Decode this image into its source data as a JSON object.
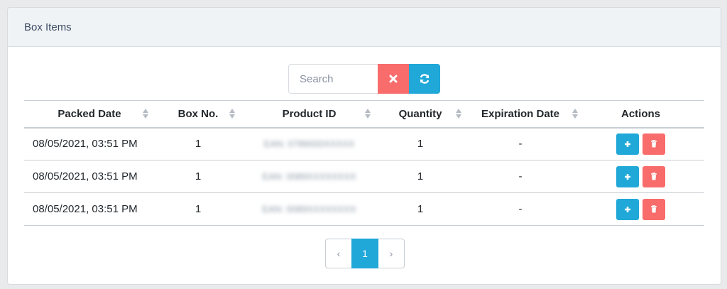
{
  "card": {
    "title": "Box Items"
  },
  "toolbar": {
    "search_placeholder": "Search",
    "search_value": "",
    "clear_icon": "times-icon",
    "refresh_icon": "refresh-icon"
  },
  "table": {
    "columns": [
      {
        "label": "Packed Date",
        "sortable": true
      },
      {
        "label": "Box No.",
        "sortable": true
      },
      {
        "label": "Product ID",
        "sortable": true
      },
      {
        "label": "Quantity",
        "sortable": true
      },
      {
        "label": "Expiration Date",
        "sortable": true
      },
      {
        "label": "Actions",
        "sortable": false
      }
    ],
    "rows": [
      {
        "packed_date": "08/05/2021, 03:51 PM",
        "box_no": "1",
        "product_id": "EAN: 0789000XXXXX",
        "quantity": "1",
        "expiration": "-"
      },
      {
        "packed_date": "08/05/2021, 03:51 PM",
        "box_no": "1",
        "product_id": "EAN: 0089XXXXXXXX",
        "quantity": "1",
        "expiration": "-"
      },
      {
        "packed_date": "08/05/2021, 03:51 PM",
        "box_no": "1",
        "product_id": "EAN: 0089XXXXXXXX",
        "quantity": "1",
        "expiration": "-"
      }
    ]
  },
  "pagination": {
    "prev": "‹",
    "current": "1",
    "next": "›"
  },
  "colors": {
    "primary": "#20a8d8",
    "danger": "#f86c6b"
  }
}
